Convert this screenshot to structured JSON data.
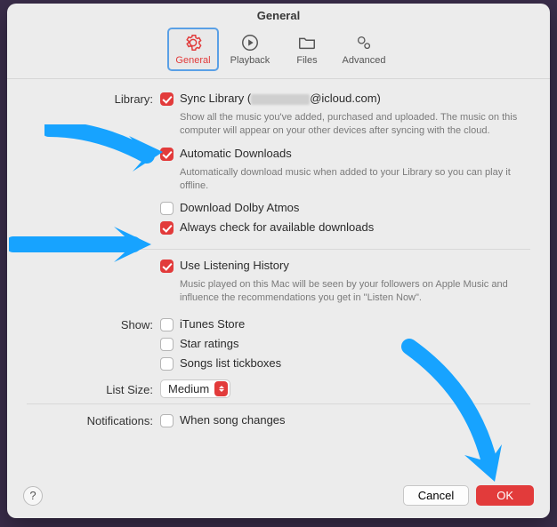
{
  "window": {
    "title": "General"
  },
  "tabs": {
    "general": "General",
    "playback": "Playback",
    "files": "Files",
    "advanced": "Advanced"
  },
  "sections": {
    "library_label": "Library:",
    "sync_prefix": "Sync Library (",
    "sync_suffix": "@icloud.com)",
    "sync_desc": "Show all the music you've added, purchased and uploaded. The music on this computer will appear on your other devices after syncing with the cloud.",
    "auto_dl": "Automatic Downloads",
    "auto_dl_desc": "Automatically download music when added to your Library so you can play it offline.",
    "dolby": "Download Dolby Atmos",
    "always_check": "Always check for available downloads",
    "listening": "Use Listening History",
    "listening_desc": "Music played on this Mac will be seen by your followers on Apple Music and influence the recommendations you get in \"Listen Now\".",
    "show_label": "Show:",
    "itunes": "iTunes Store",
    "star": "Star ratings",
    "tickboxes": "Songs list tickboxes",
    "listsize_label": "List Size:",
    "listsize_value": "Medium",
    "notifications_label": "Notifications:",
    "song_changes": "When song changes"
  },
  "buttons": {
    "help": "?",
    "cancel": "Cancel",
    "ok": "OK"
  }
}
